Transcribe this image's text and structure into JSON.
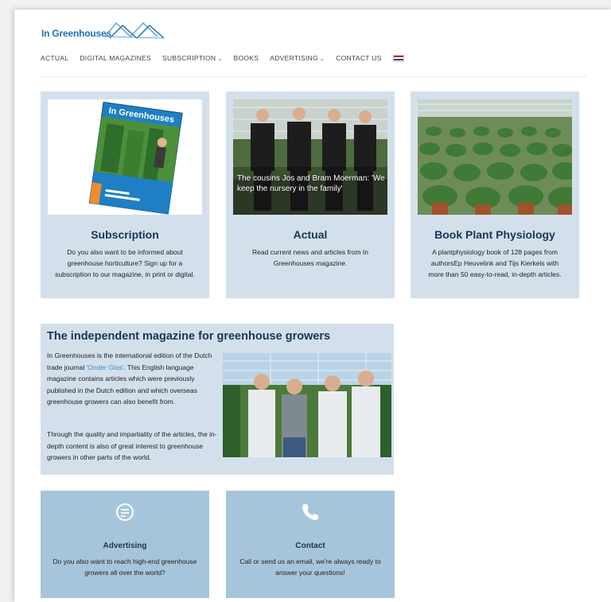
{
  "header": {
    "logo_text": "In Greenhouses",
    "nav": [
      {
        "label": "ACTUAL",
        "has_dropdown": false
      },
      {
        "label": "DIGITAL MAGAZINES",
        "has_dropdown": false
      },
      {
        "label": "SUBSCRIPTION",
        "has_dropdown": true
      },
      {
        "label": "BOOKS",
        "has_dropdown": false
      },
      {
        "label": "ADVERTISING",
        "has_dropdown": true
      },
      {
        "label": "CONTACT US",
        "has_dropdown": false
      }
    ],
    "language_flag": "dutch-flag-icon"
  },
  "cards": [
    {
      "title": "Subscription",
      "text": "Do you also want to be informed about greenhouse horticulture? Sign up for a subscription to our magazine, in print or digital.",
      "image": {
        "cover_title": "In Greenhouses"
      }
    },
    {
      "title": "Actual",
      "text": "Read current news and articles from In Greenhouses magazine.",
      "image": {
        "caption": "The cousins Jos and Bram Moerman: 'We keep the nursery in the family'"
      }
    },
    {
      "title": "Book Plant Physiology",
      "text": "A plantphysiology book of 128 pages from authorsEp Heuvelink and Tijs Kierkels with more than 50 easy-to-read, in-depth articles."
    }
  ],
  "about": {
    "title": "The independent magazine for greenhouse growers",
    "p1_before": "In Greenhouses is the international edition of the Dutch trade journal ",
    "p1_link": "'Onder Glas'",
    "p1_after": ". This English language magazine contains articles which were previously published in the Dutch edition and which overseas greenhouse growers can also benefit from.",
    "p2": "Through the quality and impartiality of the articles, the in- depth content is also of great interest to greenhouse growers in other parts of the world."
  },
  "bottom_cards": [
    {
      "title": "Advertising",
      "text": "Do you also want to reach high-end greenhouse growers all over the world?",
      "icon": "chat-bubble-icon"
    },
    {
      "title": "Contact",
      "text": "Call or send us an email, we're always ready to answer your questions!",
      "icon": "phone-icon"
    }
  ],
  "colors": {
    "card_bg": "#d3e0ec",
    "bottom_card_bg": "#a7c5da",
    "title": "#1c3553",
    "brand_blue": "#1f6fb0",
    "link": "#3a8fc7"
  }
}
